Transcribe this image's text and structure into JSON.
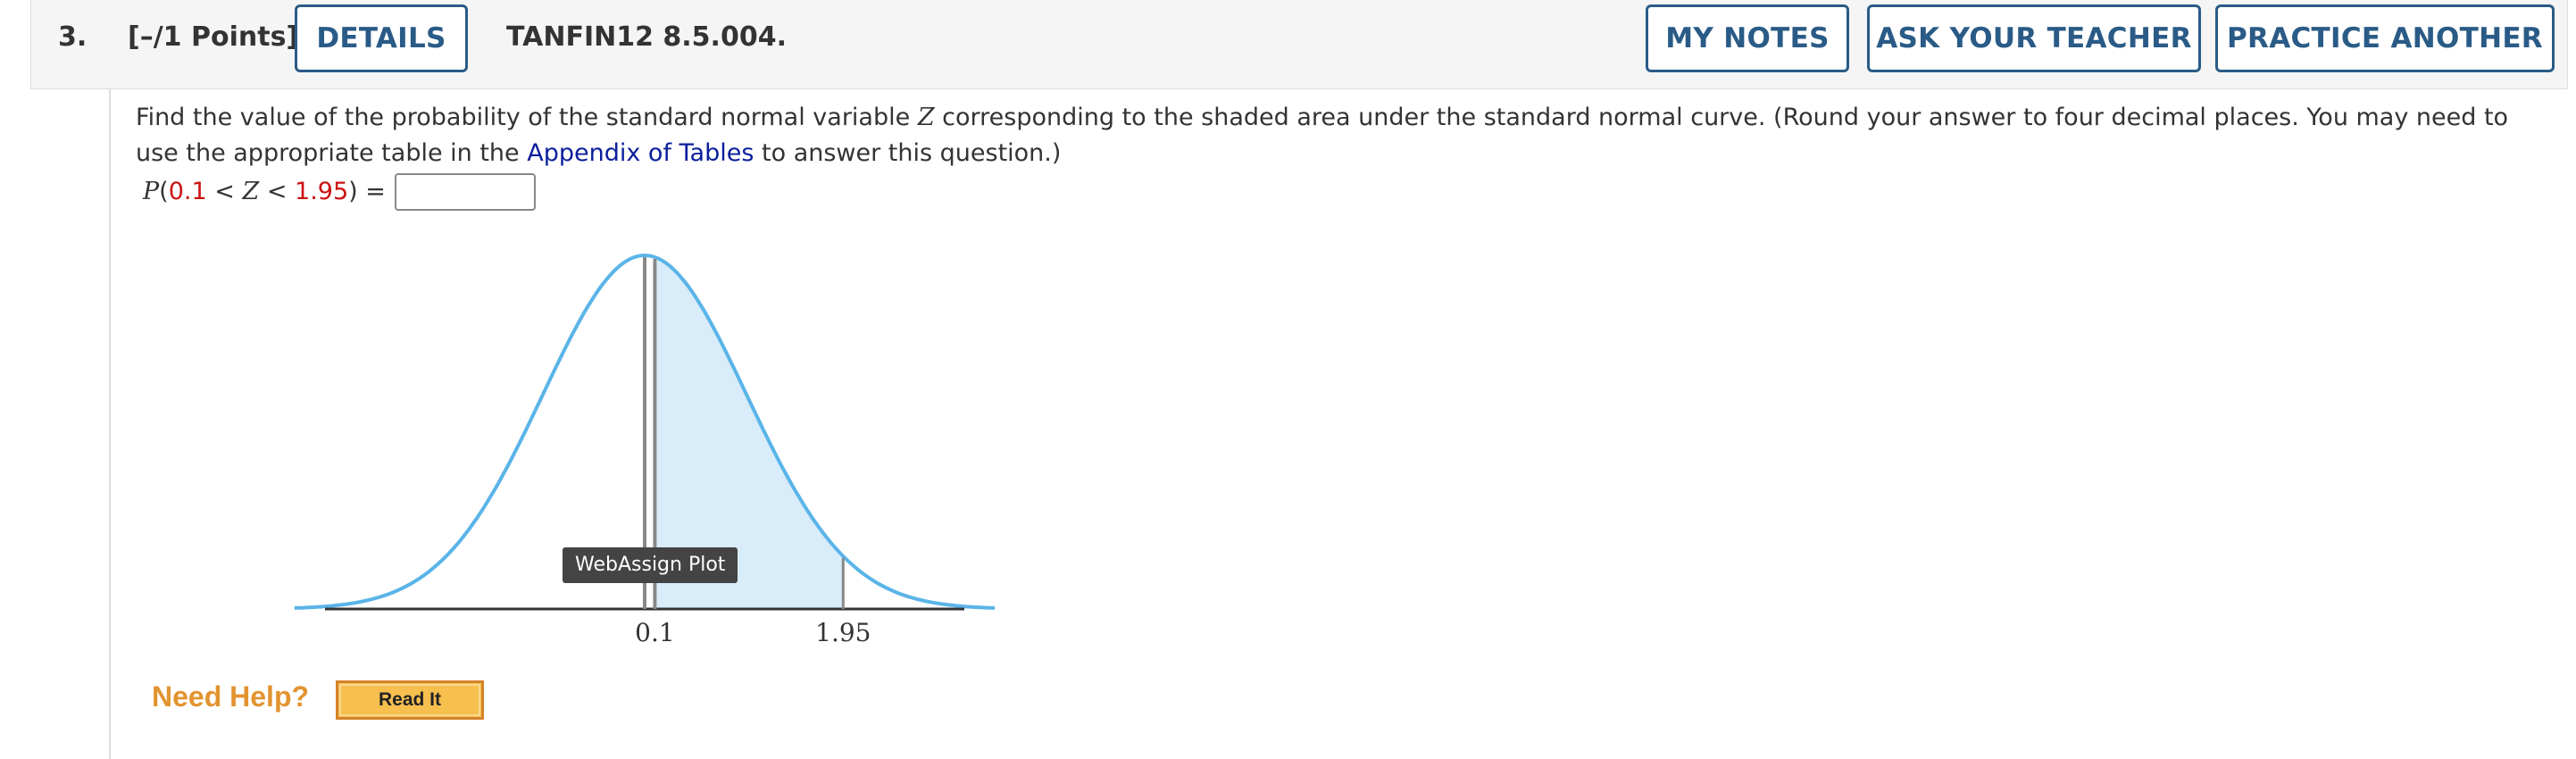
{
  "header": {
    "question_number": "3.",
    "points": "[–/1 Points]",
    "details_label": "DETAILS",
    "code": "TANFIN12 8.5.004.",
    "my_notes_label": "MY NOTES",
    "ask_teacher_label": "ASK YOUR TEACHER",
    "practice_label": "PRACTICE ANOTHER"
  },
  "question": {
    "text_1": "Find the value of the probability of the standard normal variable ",
    "var_z": "Z",
    "text_2": " corresponding to the shaded area under the standard normal curve. (Round your answer to four decimal places. You may need to use the appropriate table in the ",
    "link_text": "Appendix of Tables",
    "text_3": " to answer this question.)",
    "eq_p": "P",
    "eq_open": "(",
    "eq_lower": "0.1",
    "eq_lt1": " < ",
    "eq_z": "Z",
    "eq_lt2": " < ",
    "eq_upper": "1.95",
    "eq_close": ") =",
    "answer_value": ""
  },
  "plot": {
    "tooltip": "WebAssign Plot",
    "lower_label": "0.1",
    "upper_label": "1.95",
    "lower": 0.1,
    "upper": 1.95,
    "curve_color": "#5ab4e8",
    "fill_color": "#d8ecfa"
  },
  "help": {
    "need_help_label": "Need Help?",
    "read_it_label": "Read It"
  }
}
